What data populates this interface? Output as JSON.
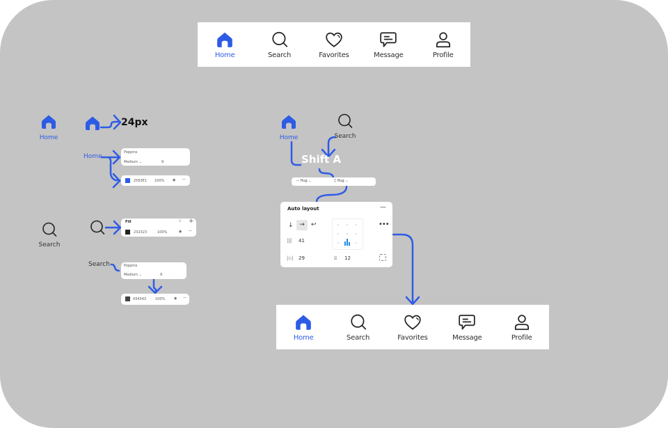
{
  "colors": {
    "canvas_bg": "#c4c4c4",
    "accent": "#2e5be6",
    "text_dark": "#2b2b2b",
    "panel_bg": "#ffffff"
  },
  "nav_top": {
    "items": [
      {
        "label": "Home",
        "icon": "home-icon",
        "active": true
      },
      {
        "label": "Search",
        "icon": "search-icon",
        "active": false
      },
      {
        "label": "Favorites",
        "icon": "heart-icon",
        "active": false
      },
      {
        "label": "Message",
        "icon": "message-icon",
        "active": false
      },
      {
        "label": "Profile",
        "icon": "profile-icon",
        "active": false
      }
    ]
  },
  "nav_bottom": {
    "items": [
      {
        "label": "Home",
        "icon": "home-icon",
        "active": true
      },
      {
        "label": "Search",
        "icon": "search-icon",
        "active": false
      },
      {
        "label": "Favorites",
        "icon": "heart-icon",
        "active": false
      },
      {
        "label": "Message",
        "icon": "message-icon",
        "active": false
      },
      {
        "label": "Profile",
        "icon": "profile-icon",
        "active": false
      }
    ]
  },
  "home_spec": {
    "icon_label": "Home",
    "size_label": "24px",
    "text_label": "Home",
    "font_panel": {
      "family": "Poppins",
      "weight": "Medium",
      "size": "9"
    },
    "fill_panel": {
      "hex": "2563E1",
      "opacity": "100%",
      "swatch": "#2e5be6"
    }
  },
  "search_spec": {
    "icon_label": "Search",
    "fill_panel": {
      "title": "Fill",
      "hex": "232323",
      "opacity": "100%",
      "swatch": "#232323"
    },
    "text_label": "Search",
    "font_panel": {
      "family": "Poppins",
      "weight": "Medium",
      "size": "9"
    },
    "text_fill_panel": {
      "hex": "434343",
      "opacity": "100%",
      "swatch": "#434343"
    }
  },
  "layout_spec": {
    "home_label": "Home",
    "search_label": "Search",
    "shortcut": "Shift A",
    "hug_bar": {
      "width": "Hug",
      "height": "Hug"
    },
    "auto_layout": {
      "title": "Auto layout",
      "spacing": "41",
      "padding_h": "29",
      "padding_v": "12"
    }
  }
}
